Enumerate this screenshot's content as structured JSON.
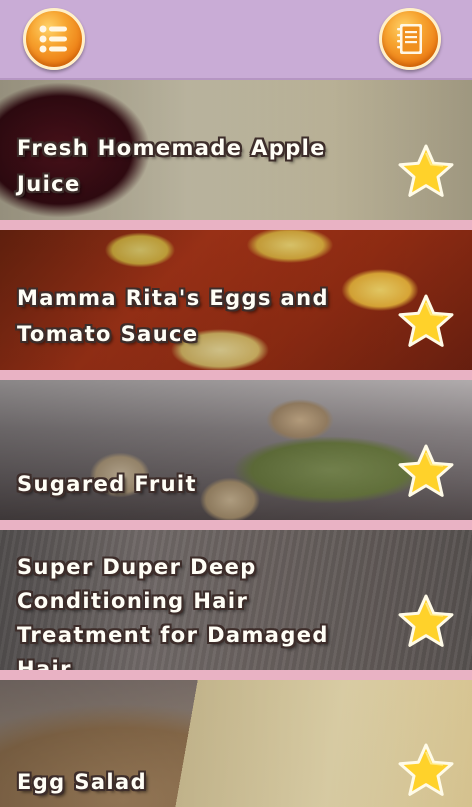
{
  "header": {
    "menu_icon": "list-menu-icon",
    "notebook_icon": "notebook-icon",
    "button_color": "#f39a2a",
    "background_color": "#c9acd6"
  },
  "recipes": [
    {
      "title": "Fresh Homemade Apple Juice",
      "favorite_icon": "star-icon"
    },
    {
      "title": "Mamma Rita's Eggs and Tomato Sauce",
      "favorite_icon": "star-icon"
    },
    {
      "title": "Sugared Fruit",
      "favorite_icon": "star-icon"
    },
    {
      "title": "Super Duper Deep Conditioning Hair Treatment for Damaged Hair",
      "favorite_icon": "star-icon"
    },
    {
      "title": "Egg Salad",
      "favorite_icon": "star-icon"
    }
  ],
  "colors": {
    "separator": "#e9b2c4",
    "star_fill": "#ffd22a",
    "title_text": "#fffef6"
  }
}
